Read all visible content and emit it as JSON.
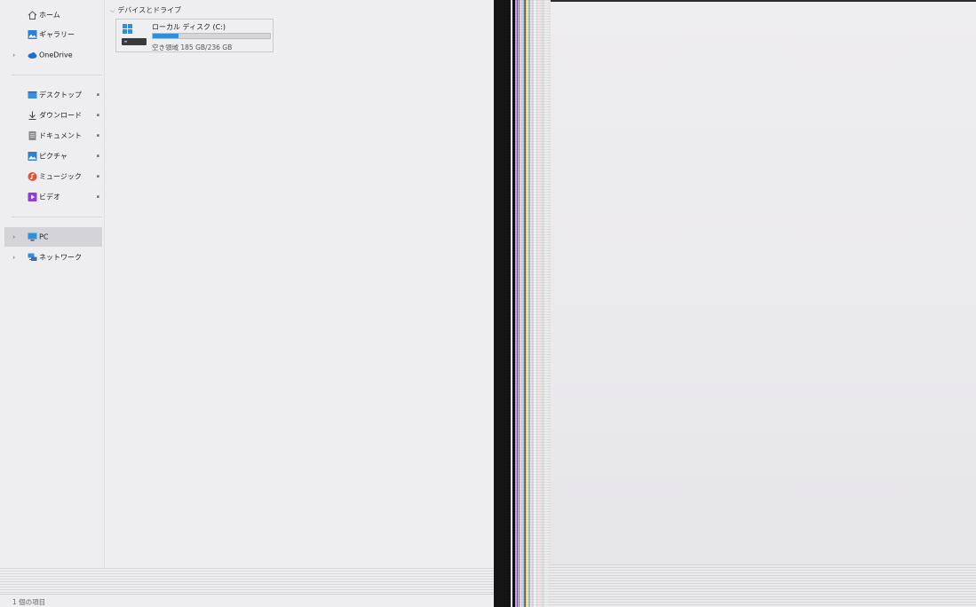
{
  "nav": {
    "items": [
      {
        "key": "home",
        "label": "ホーム",
        "icon": "home-icon",
        "chevron": false,
        "pin": false
      },
      {
        "key": "gallery",
        "label": "ギャラリー",
        "icon": "gallery-icon",
        "chevron": false,
        "pin": false
      },
      {
        "key": "onedrive",
        "label": "OneDrive",
        "icon": "cloud-icon",
        "chevron": true,
        "pin": false
      },
      {
        "key": "desktop",
        "label": "デスクトップ",
        "icon": "desktop-icon",
        "chevron": false,
        "pin": true
      },
      {
        "key": "downloads",
        "label": "ダウンロード",
        "icon": "download-icon",
        "chevron": false,
        "pin": true
      },
      {
        "key": "documents",
        "label": "ドキュメント",
        "icon": "document-icon",
        "chevron": false,
        "pin": true
      },
      {
        "key": "pictures",
        "label": "ピクチャ",
        "icon": "pictures-icon",
        "chevron": false,
        "pin": true
      },
      {
        "key": "music",
        "label": "ミュージック",
        "icon": "music-icon",
        "chevron": false,
        "pin": true
      },
      {
        "key": "videos",
        "label": "ビデオ",
        "icon": "video-icon",
        "chevron": false,
        "pin": true
      },
      {
        "key": "pc",
        "label": "PC",
        "icon": "pc-icon",
        "chevron": true,
        "pin": false,
        "selected": true
      },
      {
        "key": "network",
        "label": "ネットワーク",
        "icon": "network-icon",
        "chevron": true,
        "pin": false
      }
    ]
  },
  "content": {
    "group_header": "デバイスとドライブ",
    "drive": {
      "name": "ローカル ディスク (C:)",
      "free_text": "空き領域 185 GB/236 GB",
      "used_fraction": 0.216
    }
  },
  "status": {
    "text": "1 個の項目"
  },
  "colors": {
    "accent": "#2f8fd8",
    "selected_bg": "#d4d3d7",
    "window_bg": "#eeedef"
  }
}
